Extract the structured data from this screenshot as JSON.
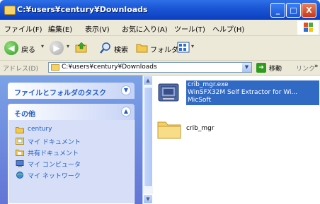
{
  "window": {
    "title": "C:¥users¥century¥Downloads",
    "buttons": {
      "minimize": "_",
      "maximize": "□",
      "close": "X"
    }
  },
  "menu": [
    "ファイル(F)",
    "編集(E)",
    "表示(V)",
    "お気に入り(A)",
    "ツール(T)",
    "ヘルプ(H)"
  ],
  "toolbar": {
    "back_label": "戻る",
    "search_label": "検索",
    "folders_label": "フォルダ"
  },
  "address": {
    "label": "アドレス(D)",
    "value": "C:¥users¥century¥Downloads",
    "go_label": "移動",
    "links_label": "リンク"
  },
  "left_panel": {
    "tasks_header": "ファイルとフォルダのタスク",
    "other_header": "その他",
    "other_items": [
      {
        "label": "century",
        "icon": "folder-icon"
      },
      {
        "label": "マイ ドキュメント",
        "icon": "my-documents-icon"
      },
      {
        "label": "共有ドキュメント",
        "icon": "shared-documents-icon"
      },
      {
        "label": "マイ コンピュータ",
        "icon": "my-computer-icon"
      },
      {
        "label": "マイ ネットワーク",
        "icon": "my-network-icon"
      }
    ]
  },
  "files": [
    {
      "name": "crib_mgr.exe",
      "description": "WinSFX32M Self Extractor for Wi...",
      "company": "MicSoft",
      "selected": true,
      "icon": "exe-icon"
    },
    {
      "name": "crib_mgr",
      "selected": false,
      "icon": "folder-icon"
    }
  ],
  "colors": {
    "titlebar": "#0b3fc0",
    "selection": "#316ac5",
    "task_panel": "#6375d6",
    "link_text": "#215dc6"
  }
}
